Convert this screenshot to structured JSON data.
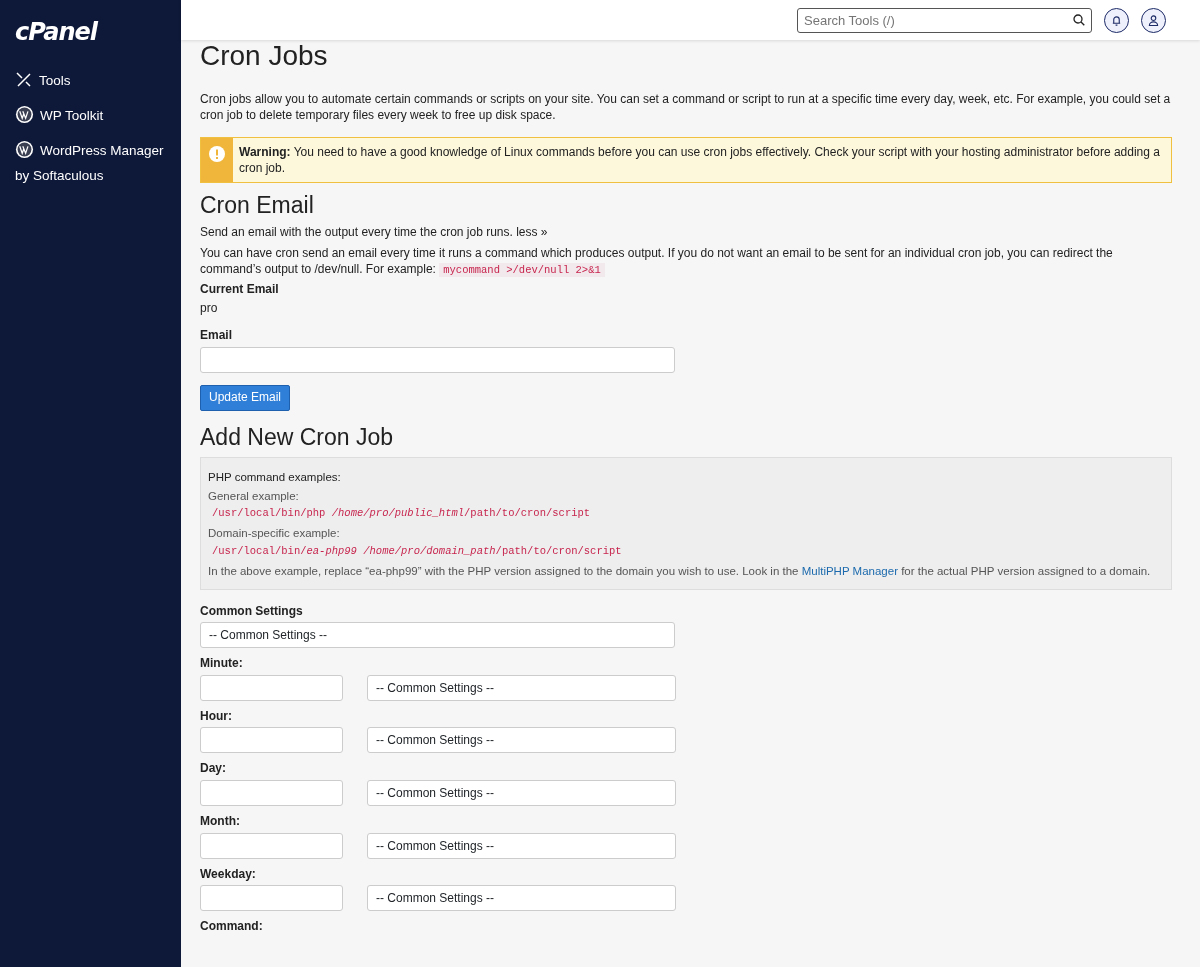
{
  "sidebar": {
    "logo": "cPanel",
    "items": [
      {
        "label": "Tools",
        "kind": "tools"
      },
      {
        "label": "WP Toolkit",
        "kind": "wordpress"
      },
      {
        "label": "WordPress Manager by Softaculous",
        "kind": "wordpress"
      }
    ]
  },
  "topbar": {
    "search": {
      "placeholder": "Search Tools (/)"
    }
  },
  "page": {
    "title": "Cron Jobs",
    "intro": "Cron jobs allow you to automate certain commands or scripts on your site. You can set a command or script to run at a specific time every day, week, etc. For example, you could set a cron job to delete temporary files every week to free up disk space.",
    "warning": "**Warning:** You need to have a good knowledge of Linux commands before you can use cron jobs effectively. Check your script with your hosting administrator before adding a cron job."
  },
  "cron_email": {
    "title": "Cron Email",
    "summary": "Send an email with the output every time the cron job runs. less »",
    "details": "You can have cron send an email every time it runs a command which produces output. If you do not want an email to be sent for an individual cron job, you can redirect the command’s output to /dev/null. For example:",
    "example_code": "mycommand >/dev/null 2>&1",
    "current_label": "Current Email",
    "current_value": "pro",
    "email_label": "Email",
    "button": "Update Email"
  },
  "add_job": {
    "title": "Add New Cron Job",
    "examples_heading": "PHP command examples:",
    "examples": [
      {
        "label": "General example:",
        "code": "/usr/local/bin/php */home/pro/public_html*/path/to/cron/script"
      },
      {
        "label": "Domain-specific example:",
        "code": "/usr/local/bin/*ea-php99* */home/pro/domain_path*/path/to/cron/script"
      }
    ],
    "note_before": "In the above example, replace “ea-php99” with the PHP version assigned to the domain you wish to use. Look in the",
    "note_link": "MultiPHP Manager",
    "note_after": "for the actual PHP version assigned to a domain.",
    "fields": [
      {
        "kind": "select",
        "label": "Common Settings",
        "option": "-- Common Settings --"
      },
      {
        "kind": "input_select",
        "label": "Minute:",
        "option": "-- Common Settings --"
      },
      {
        "kind": "input_select",
        "label": "Hour:",
        "option": "-- Common Settings --"
      },
      {
        "kind": "input_select",
        "label": "Day:",
        "option": "-- Common Settings --"
      },
      {
        "kind": "input_select",
        "label": "Month:",
        "option": "-- Common Settings --"
      },
      {
        "kind": "input_select",
        "label": "Weekday:",
        "option": "-- Common Settings --"
      },
      {
        "kind": "label",
        "label": "Command:"
      }
    ]
  }
}
